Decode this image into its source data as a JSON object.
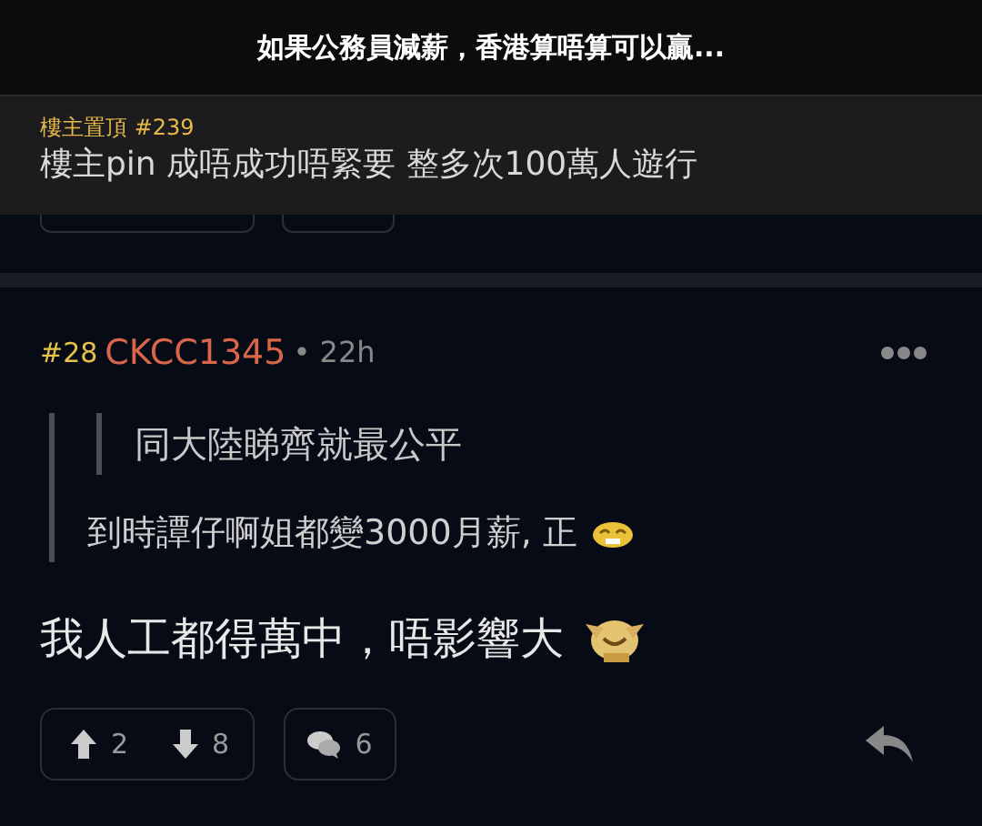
{
  "header": {
    "title": "如果公務員減薪，香港算唔算可以贏..."
  },
  "pinned": {
    "label": "樓主置頂 #239",
    "text": "樓主pin 成唔成功唔緊要 整多次100萬人遊行"
  },
  "post": {
    "number": "#28",
    "username": "CKCC1345",
    "time": "• 22h",
    "quote": {
      "nested_quote": "同大陸睇齊就最公平",
      "text": "到時譚仔啊姐都變3000月薪, 正"
    },
    "body": "我人工都得萬中，唔影響大",
    "upvotes": "2",
    "downvotes": "8",
    "comments": "6"
  }
}
